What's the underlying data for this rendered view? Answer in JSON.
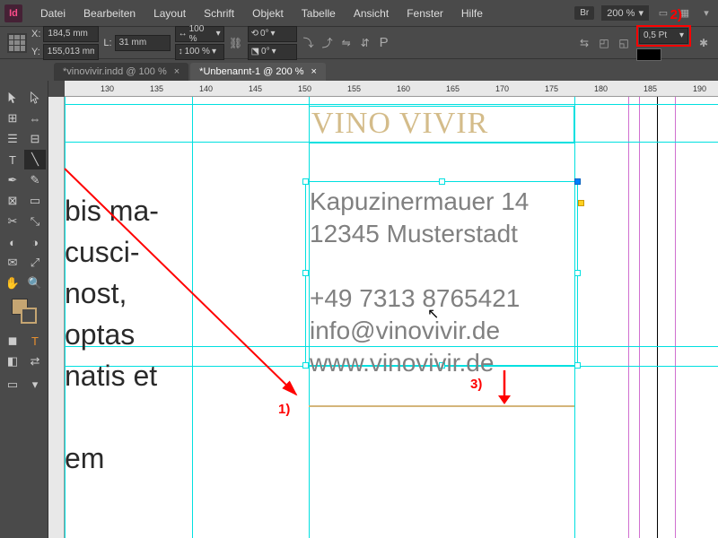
{
  "menubar": [
    "Datei",
    "Bearbeiten",
    "Layout",
    "Schrift",
    "Objekt",
    "Tabelle",
    "Ansicht",
    "Fenster",
    "Hilfe"
  ],
  "br_label": "Br",
  "zoom": "200 %",
  "control": {
    "x_label": "X:",
    "x": "184,5 mm",
    "y_label": "Y:",
    "y": "155,013 mm",
    "l_label": "L:",
    "l": "31 mm",
    "scale_x": "100 %",
    "scale_y": "100 %",
    "rot": "0°",
    "shear": "0°",
    "stroke_weight": "0,5 Pt"
  },
  "tabs": [
    {
      "label": "*vinovivir.indd @ 100 %",
      "active": false
    },
    {
      "label": "*Unbenannt-1 @ 200 %",
      "active": true
    }
  ],
  "ruler_marks": [
    "130",
    "135",
    "140",
    "145",
    "150",
    "155",
    "160",
    "165",
    "170",
    "175",
    "180",
    "185",
    "190"
  ],
  "doc": {
    "brand": "VINO VIVIR",
    "addr1": "Kapuzinermauer 14",
    "addr2": "12345 Musterstadt",
    "phone": "+49 7313 8765421",
    "email": "info@vinovivir.de",
    "web": "www.vinovivir.de",
    "body_lines": [
      "bis ma-",
      "cusci-",
      "nost,",
      "  optas",
      "natis et",
      "",
      "em",
      "",
      ""
    ]
  },
  "brand_color": "#d4bc8a",
  "anno": {
    "a1": "1)",
    "a2": "2)",
    "a3": "3)"
  }
}
